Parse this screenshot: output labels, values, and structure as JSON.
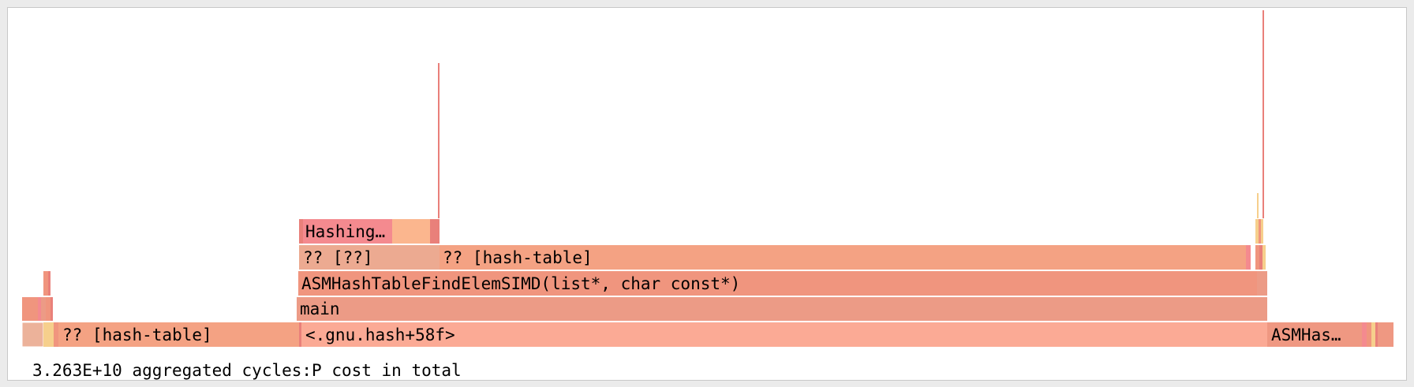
{
  "footer": {
    "cost_total": "3.263E+10",
    "cost_suffix": "aggregated cycles:P cost in total"
  },
  "frame_labels": {
    "hash_table_left": "?? [hash-table]",
    "gnu_hash": "<.gnu.hash+58f>",
    "asmhash_right": "ASMHas…",
    "main": "main",
    "find_elem": "ASMHashTableFindElemSIMD(list*, char const*)",
    "unknown": "?? [??]",
    "hash_table_center": "?? [hash-table]",
    "hashing": "Hashing…"
  },
  "colors": {
    "panel_bg": "#ffffff",
    "page_bg": "#ebebeb",
    "frame_light": "#f9a88f",
    "frame_mid": "#f0957e",
    "frame_salmon": "#ec9b86",
    "frame_pink": "#f48a8f",
    "frame_peach": "#fbb68e",
    "frame_tan": "#ecb29a",
    "frame_red": "#e9807a",
    "frame_yellow": "#f6cf8c"
  }
}
